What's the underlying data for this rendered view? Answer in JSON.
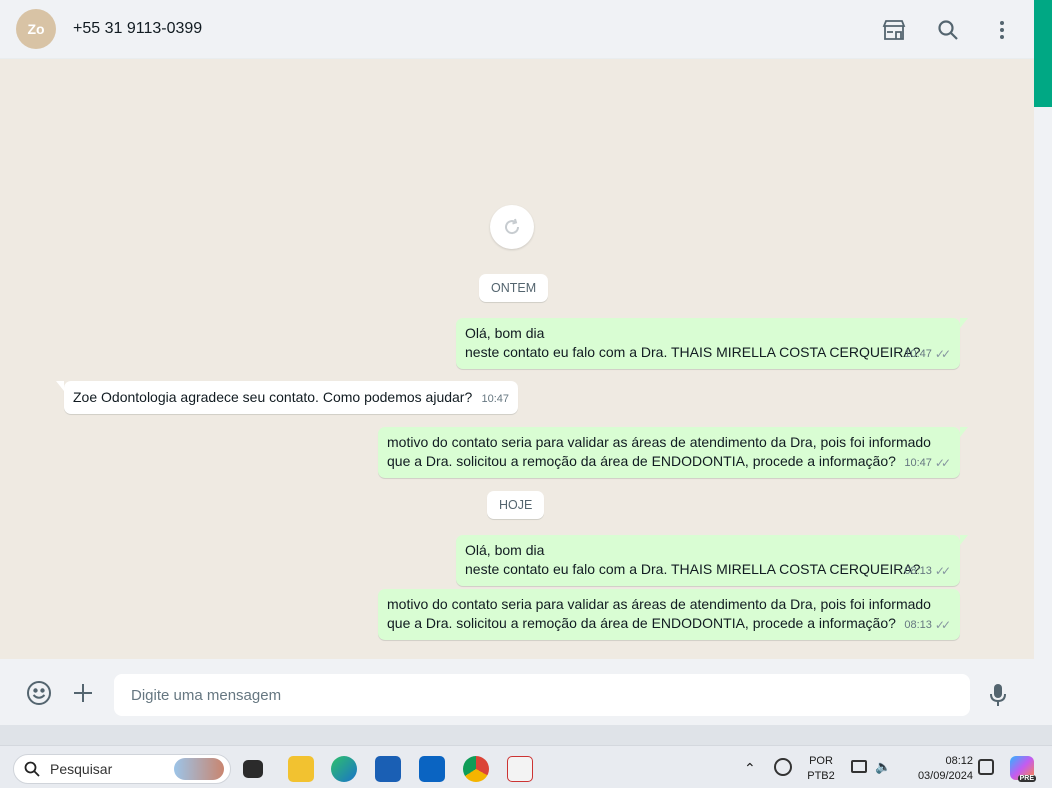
{
  "header": {
    "contact": "+55 31 9113-0399",
    "avatar_text": "Zo",
    "icons": [
      "shop-icon",
      "search-icon",
      "menu-dots-icon"
    ]
  },
  "chat": {
    "days": {
      "yesterday": "ONTEM",
      "today": "HOJE"
    },
    "messages": [
      {
        "dir": "out",
        "line1": "Olá, bom dia",
        "line2": "neste contato eu falo com a Dra. THAIS MIRELLA COSTA CERQUEIRA?",
        "time": "10:47"
      },
      {
        "dir": "in",
        "line1": "Zoe Odontologia agradece seu contato. Como podemos ajudar?",
        "time": "10:47"
      },
      {
        "dir": "out",
        "line1": "motivo do contato seria para validar as áreas de atendimento da Dra, pois foi informado",
        "line2": "que a Dra. solicitou a remoção da área de ENDODONTIA, procede a informação?",
        "time": "10:47"
      },
      {
        "dir": "out",
        "line1": "Olá, bom dia",
        "line2": "neste contato eu falo com a Dra. THAIS MIRELLA COSTA CERQUEIRA?",
        "time": "08:13"
      },
      {
        "dir": "out",
        "line1": "motivo do contato seria para validar as áreas de atendimento da Dra, pois foi informado",
        "line2": "que a Dra. solicitou a remoção da área de ENDODONTIA, procede a informação?",
        "time": "08:13"
      }
    ]
  },
  "composer": {
    "placeholder": "Digite uma mensagem"
  },
  "taskbar": {
    "search_label": "Pesquisar",
    "lang_top": "POR",
    "lang_bottom": "PTB2",
    "time": "08:12",
    "date": "03/09/2024",
    "copilot_badge": "PRE"
  },
  "colors": {
    "outgoing": "#d9fdd3",
    "incoming": "#ffffff",
    "accent": "#00a884",
    "background": "#efeae2"
  }
}
